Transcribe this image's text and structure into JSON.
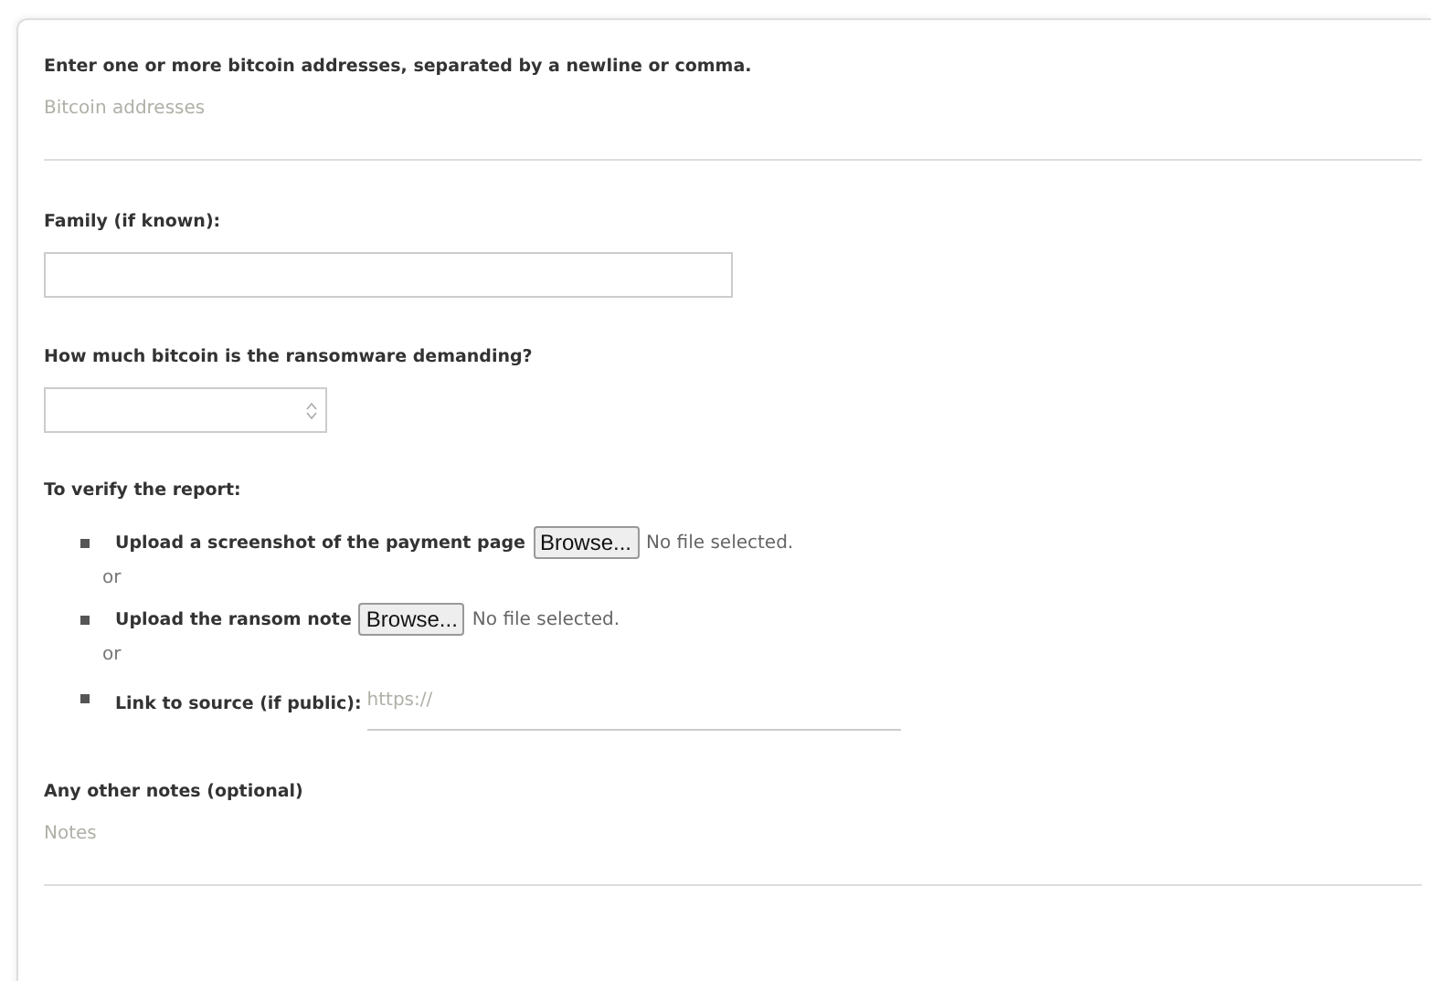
{
  "addresses": {
    "label": "Enter one or more bitcoin addresses, separated by a newline or comma.",
    "placeholder": "Bitcoin addresses"
  },
  "family": {
    "label": "Family (if known):"
  },
  "amount": {
    "label": "How much bitcoin is the ransomware demanding?"
  },
  "verify": {
    "label": "To verify the report:",
    "items": [
      {
        "kind": "file",
        "label": "Upload a screenshot of the payment page",
        "button": "Browse...",
        "status": "No file selected."
      },
      {
        "kind": "separator",
        "text": "or"
      },
      {
        "kind": "file",
        "label": "Upload the ransom note",
        "button": "Browse...",
        "status": "No file selected."
      },
      {
        "kind": "separator",
        "text": "or"
      },
      {
        "kind": "link",
        "label": "Link to source (if public):",
        "placeholder": "https://"
      }
    ]
  },
  "notes": {
    "label": "Any other notes (optional)",
    "placeholder": "Notes"
  }
}
